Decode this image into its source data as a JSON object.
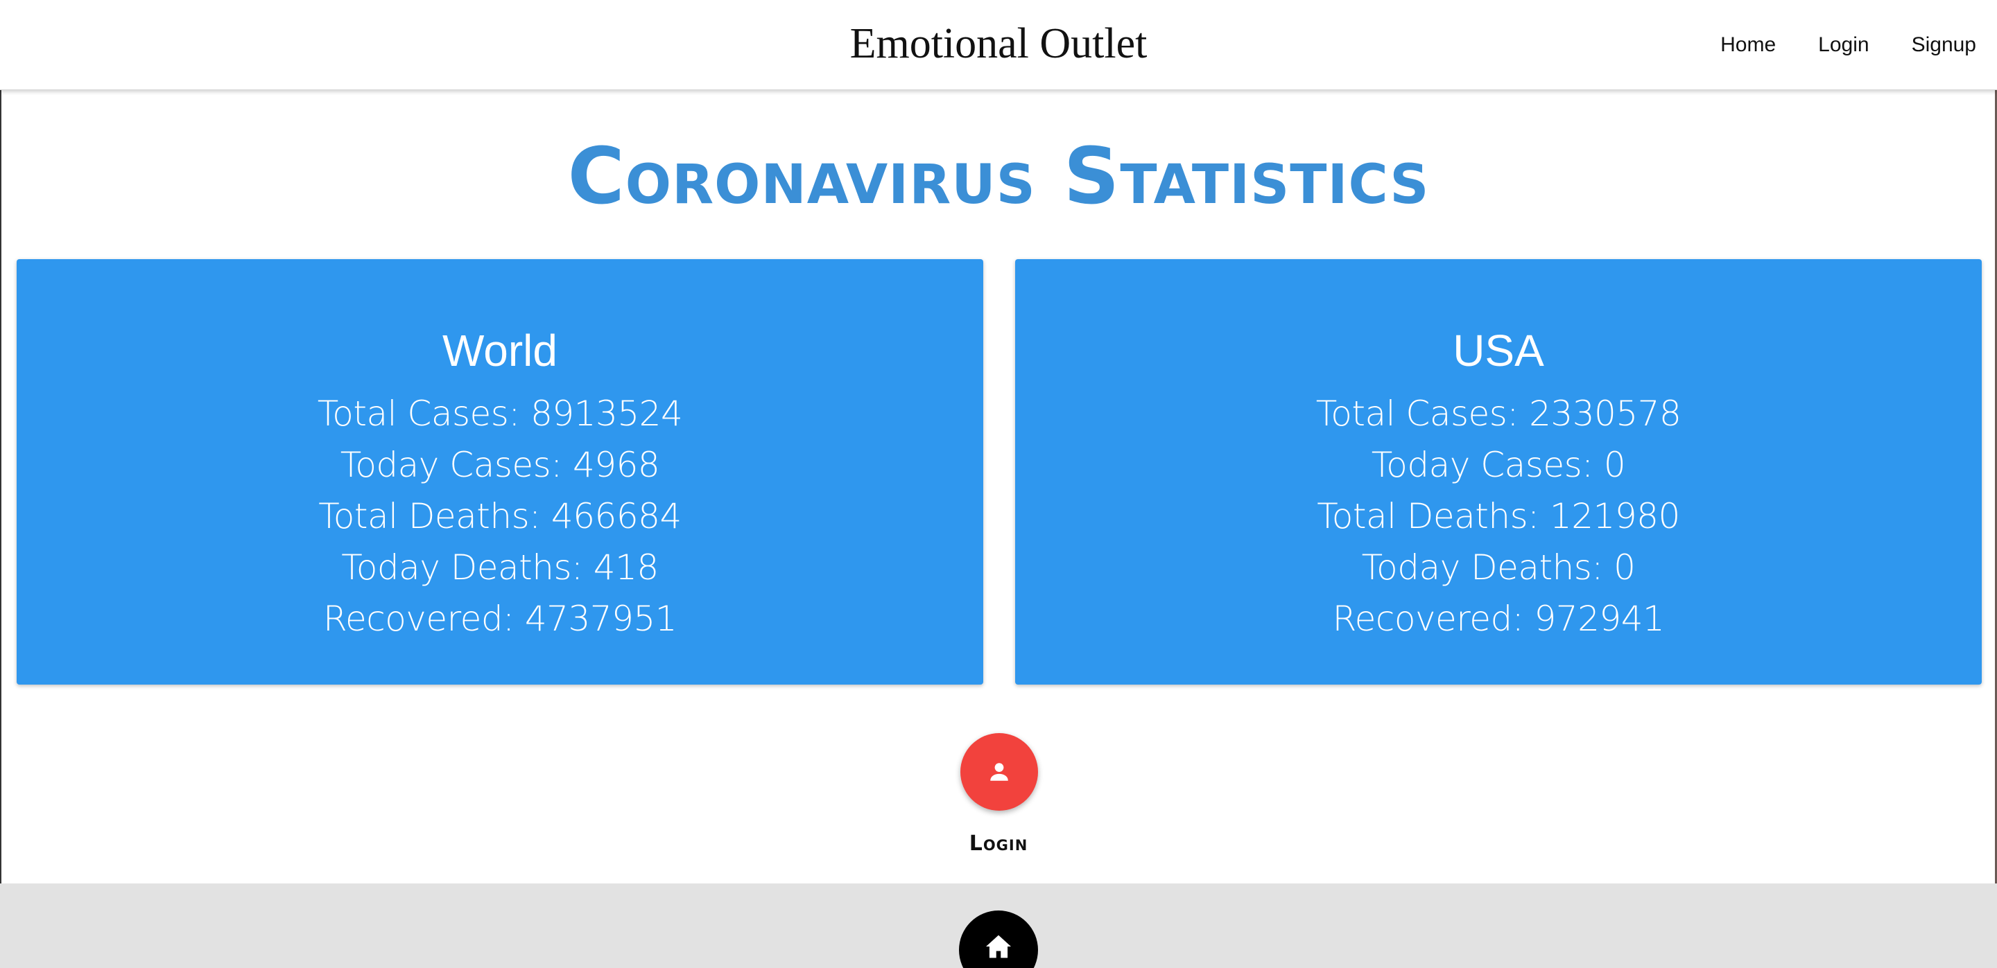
{
  "header": {
    "brand": "Emotional Outlet",
    "nav": [
      "Home",
      "Login",
      "Signup"
    ]
  },
  "main": {
    "title": "Coronavirus Statistics",
    "cards": [
      {
        "region": "World",
        "stats": [
          "Total Cases: 8913524",
          "Today Cases: 4968",
          "Total Deaths: 466684",
          "Today Deaths: 418",
          "Recovered: 4737951"
        ]
      },
      {
        "region": "USA",
        "stats": [
          "Total Cases: 2330578",
          "Today Cases: 0",
          "Total Deaths: 121980",
          "Today Deaths: 0",
          "Recovered: 972941"
        ]
      }
    ],
    "login_button": {
      "icon": "person-icon",
      "label": "Login",
      "color": "#f2423d"
    }
  },
  "footer": {
    "home_button": {
      "icon": "home-icon",
      "color": "#000000"
    }
  },
  "colors": {
    "accent": "#3b8fd6",
    "card_bg": "#2f97ee",
    "footer_bg": "#e2e2e2"
  }
}
